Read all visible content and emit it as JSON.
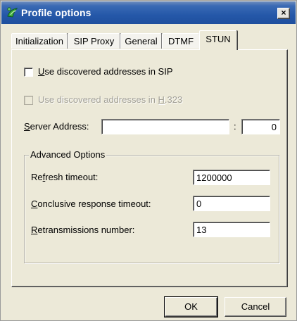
{
  "window": {
    "title": "Profile options",
    "close_label": "×"
  },
  "tabs": [
    {
      "label": "Initialization",
      "active": false
    },
    {
      "label": "SIP Proxy",
      "active": false
    },
    {
      "label": "General",
      "active": false
    },
    {
      "label": "DTMF",
      "active": false
    },
    {
      "label": "STUN",
      "active": true
    }
  ],
  "stun": {
    "use_sip": {
      "label_u": "U",
      "label_rest": "se discovered addresses in SIP",
      "checked": false,
      "enabled": true
    },
    "use_h323": {
      "label_pre": "Use discovered addresses in ",
      "label_u": "H",
      "label_post": ".323",
      "checked": false,
      "enabled": false
    },
    "server": {
      "label_u": "S",
      "label_rest": "erver Address:",
      "address": "",
      "colon": ":",
      "port": "0"
    },
    "advanced": {
      "title": "Advanced Options",
      "refresh": {
        "label_pre": "Re",
        "label_u": "f",
        "label_rest": "resh timeout:",
        "value": "1200000"
      },
      "conclusive": {
        "label_u": "C",
        "label_rest": "onclusive response timeout:",
        "value": "0"
      },
      "retrans": {
        "label_u": "R",
        "label_rest": "etransmissions number:",
        "value": "13"
      }
    }
  },
  "buttons": {
    "ok": "OK",
    "cancel": "Cancel"
  },
  "colors": {
    "titlebar": "#2558a9",
    "face": "#ece9d8"
  }
}
